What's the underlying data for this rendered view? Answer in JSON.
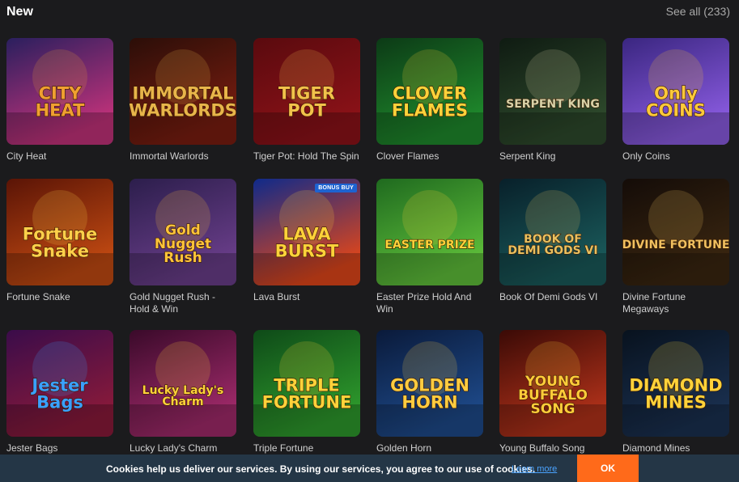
{
  "header": {
    "title": "New",
    "see_all": "See all (233)"
  },
  "games": [
    {
      "title": "City Heat",
      "art": "CITY\nHEAT",
      "colors": [
        "#2a1f5e",
        "#c2327a",
        "#f0a030"
      ]
    },
    {
      "title": "Immortal Warlords",
      "art": "IMMORTAL\nWARLORDS",
      "colors": [
        "#2b0e08",
        "#7a1d10",
        "#e8b54a"
      ]
    },
    {
      "title": "Tiger Pot: Hold The Spin",
      "art": "TIGER\nPOT",
      "colors": [
        "#5a0a0e",
        "#8c1218",
        "#f2c24b"
      ]
    },
    {
      "title": "Clover Flames",
      "art": "CLOVER\nFLAMES",
      "colors": [
        "#0c3a16",
        "#1f8a2c",
        "#ffd23a"
      ]
    },
    {
      "title": "Serpent King",
      "art": "SERPENT KING",
      "colors": [
        "#0f1b12",
        "#2e4a2c",
        "#d8d2a8"
      ]
    },
    {
      "title": "Only Coins",
      "art": "Only\nCOINS",
      "colors": [
        "#3a2680",
        "#8a5be0",
        "#ffc93a"
      ]
    },
    {
      "title": "Fortune Snake",
      "art": "Fortune\nSnake",
      "colors": [
        "#5a1406",
        "#c24a12",
        "#ffd04a"
      ]
    },
    {
      "title": "Gold Nugget Rush - Hold & Win",
      "art": "Gold\nNugget\nRush",
      "colors": [
        "#2c1e4c",
        "#6a3e8a",
        "#ffc43a"
      ]
    },
    {
      "title": "Lava Burst",
      "art": "LAVA\nBURST",
      "colors": [
        "#0f2a8a",
        "#e0461a",
        "#ffd23a"
      ],
      "badge": "BONUS BUY"
    },
    {
      "title": "Easter Prize Hold And Win",
      "art": "EASTER PRIZE",
      "colors": [
        "#1f6a1f",
        "#5fbf3a",
        "#ffd43a"
      ]
    },
    {
      "title": "Book Of Demi Gods VI",
      "art": "BOOK OF\nDEMI GODS VI",
      "colors": [
        "#08202a",
        "#1a5a5a",
        "#e8c060"
      ]
    },
    {
      "title": "Divine Fortune Megaways",
      "art": "DIVINE FORTUNE",
      "colors": [
        "#140c08",
        "#3a2610",
        "#f0c060"
      ]
    },
    {
      "title": "Jester Bags",
      "art": "Jester\nBags",
      "colors": [
        "#3a0c4a",
        "#8a1a3a",
        "#3aa0ff"
      ]
    },
    {
      "title": "Lucky Lady's Charm Deluxe Buy Bonus",
      "art": "Lucky Lady's\nCharm",
      "colors": [
        "#3a0a2a",
        "#a02a6a",
        "#ffd23a"
      ]
    },
    {
      "title": "Triple Fortune",
      "art": "TRIPLE\nFORTUNE",
      "colors": [
        "#0e4a18",
        "#2e9a2c",
        "#ffd23a"
      ]
    },
    {
      "title": "Golden Horn",
      "art": "GOLDEN\nHORN",
      "colors": [
        "#0a1a3a",
        "#1e4a8a",
        "#ffcc40"
      ]
    },
    {
      "title": "Young Buffalo Song",
      "art": "YOUNG\nBUFFALO\nSONG",
      "colors": [
        "#3a0a06",
        "#b2321a",
        "#ffcc3a"
      ]
    },
    {
      "title": "Diamond Mines",
      "art": "DIAMOND\nMINES",
      "colors": [
        "#08121e",
        "#1a3050",
        "#ffd23a"
      ]
    }
  ],
  "cookie_banner": {
    "text": "Cookies help us deliver our services. By using our services, you agree to our use of cookies.",
    "link": "Learn more",
    "ok": "OK"
  }
}
